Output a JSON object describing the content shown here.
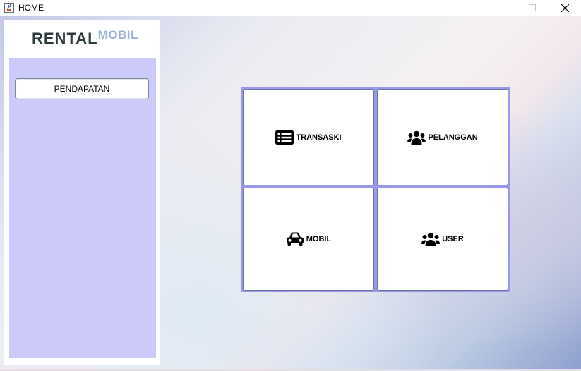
{
  "window": {
    "title": "HOME",
    "controls": {
      "minimize": "minimize-icon",
      "maximize": "maximize-icon",
      "close": "close-icon"
    }
  },
  "sidebar": {
    "logo_main": "RENTAL",
    "logo_sub": "MOBIL",
    "buttons": [
      {
        "label": "PENDAPATAN"
      }
    ]
  },
  "menu": {
    "tiles": [
      {
        "label": "TRANSASKI",
        "icon": "list-icon"
      },
      {
        "label": "PELANGGAN",
        "icon": "users-icon"
      },
      {
        "label": "MOBIL",
        "icon": "car-icon"
      },
      {
        "label": "USER",
        "icon": "users-icon"
      }
    ]
  },
  "colors": {
    "sidebar_panel": "#cccafa",
    "grid_border": "#9a98ea",
    "logo_main": "#2e3a3c",
    "logo_sub": "#9cb3d8"
  }
}
